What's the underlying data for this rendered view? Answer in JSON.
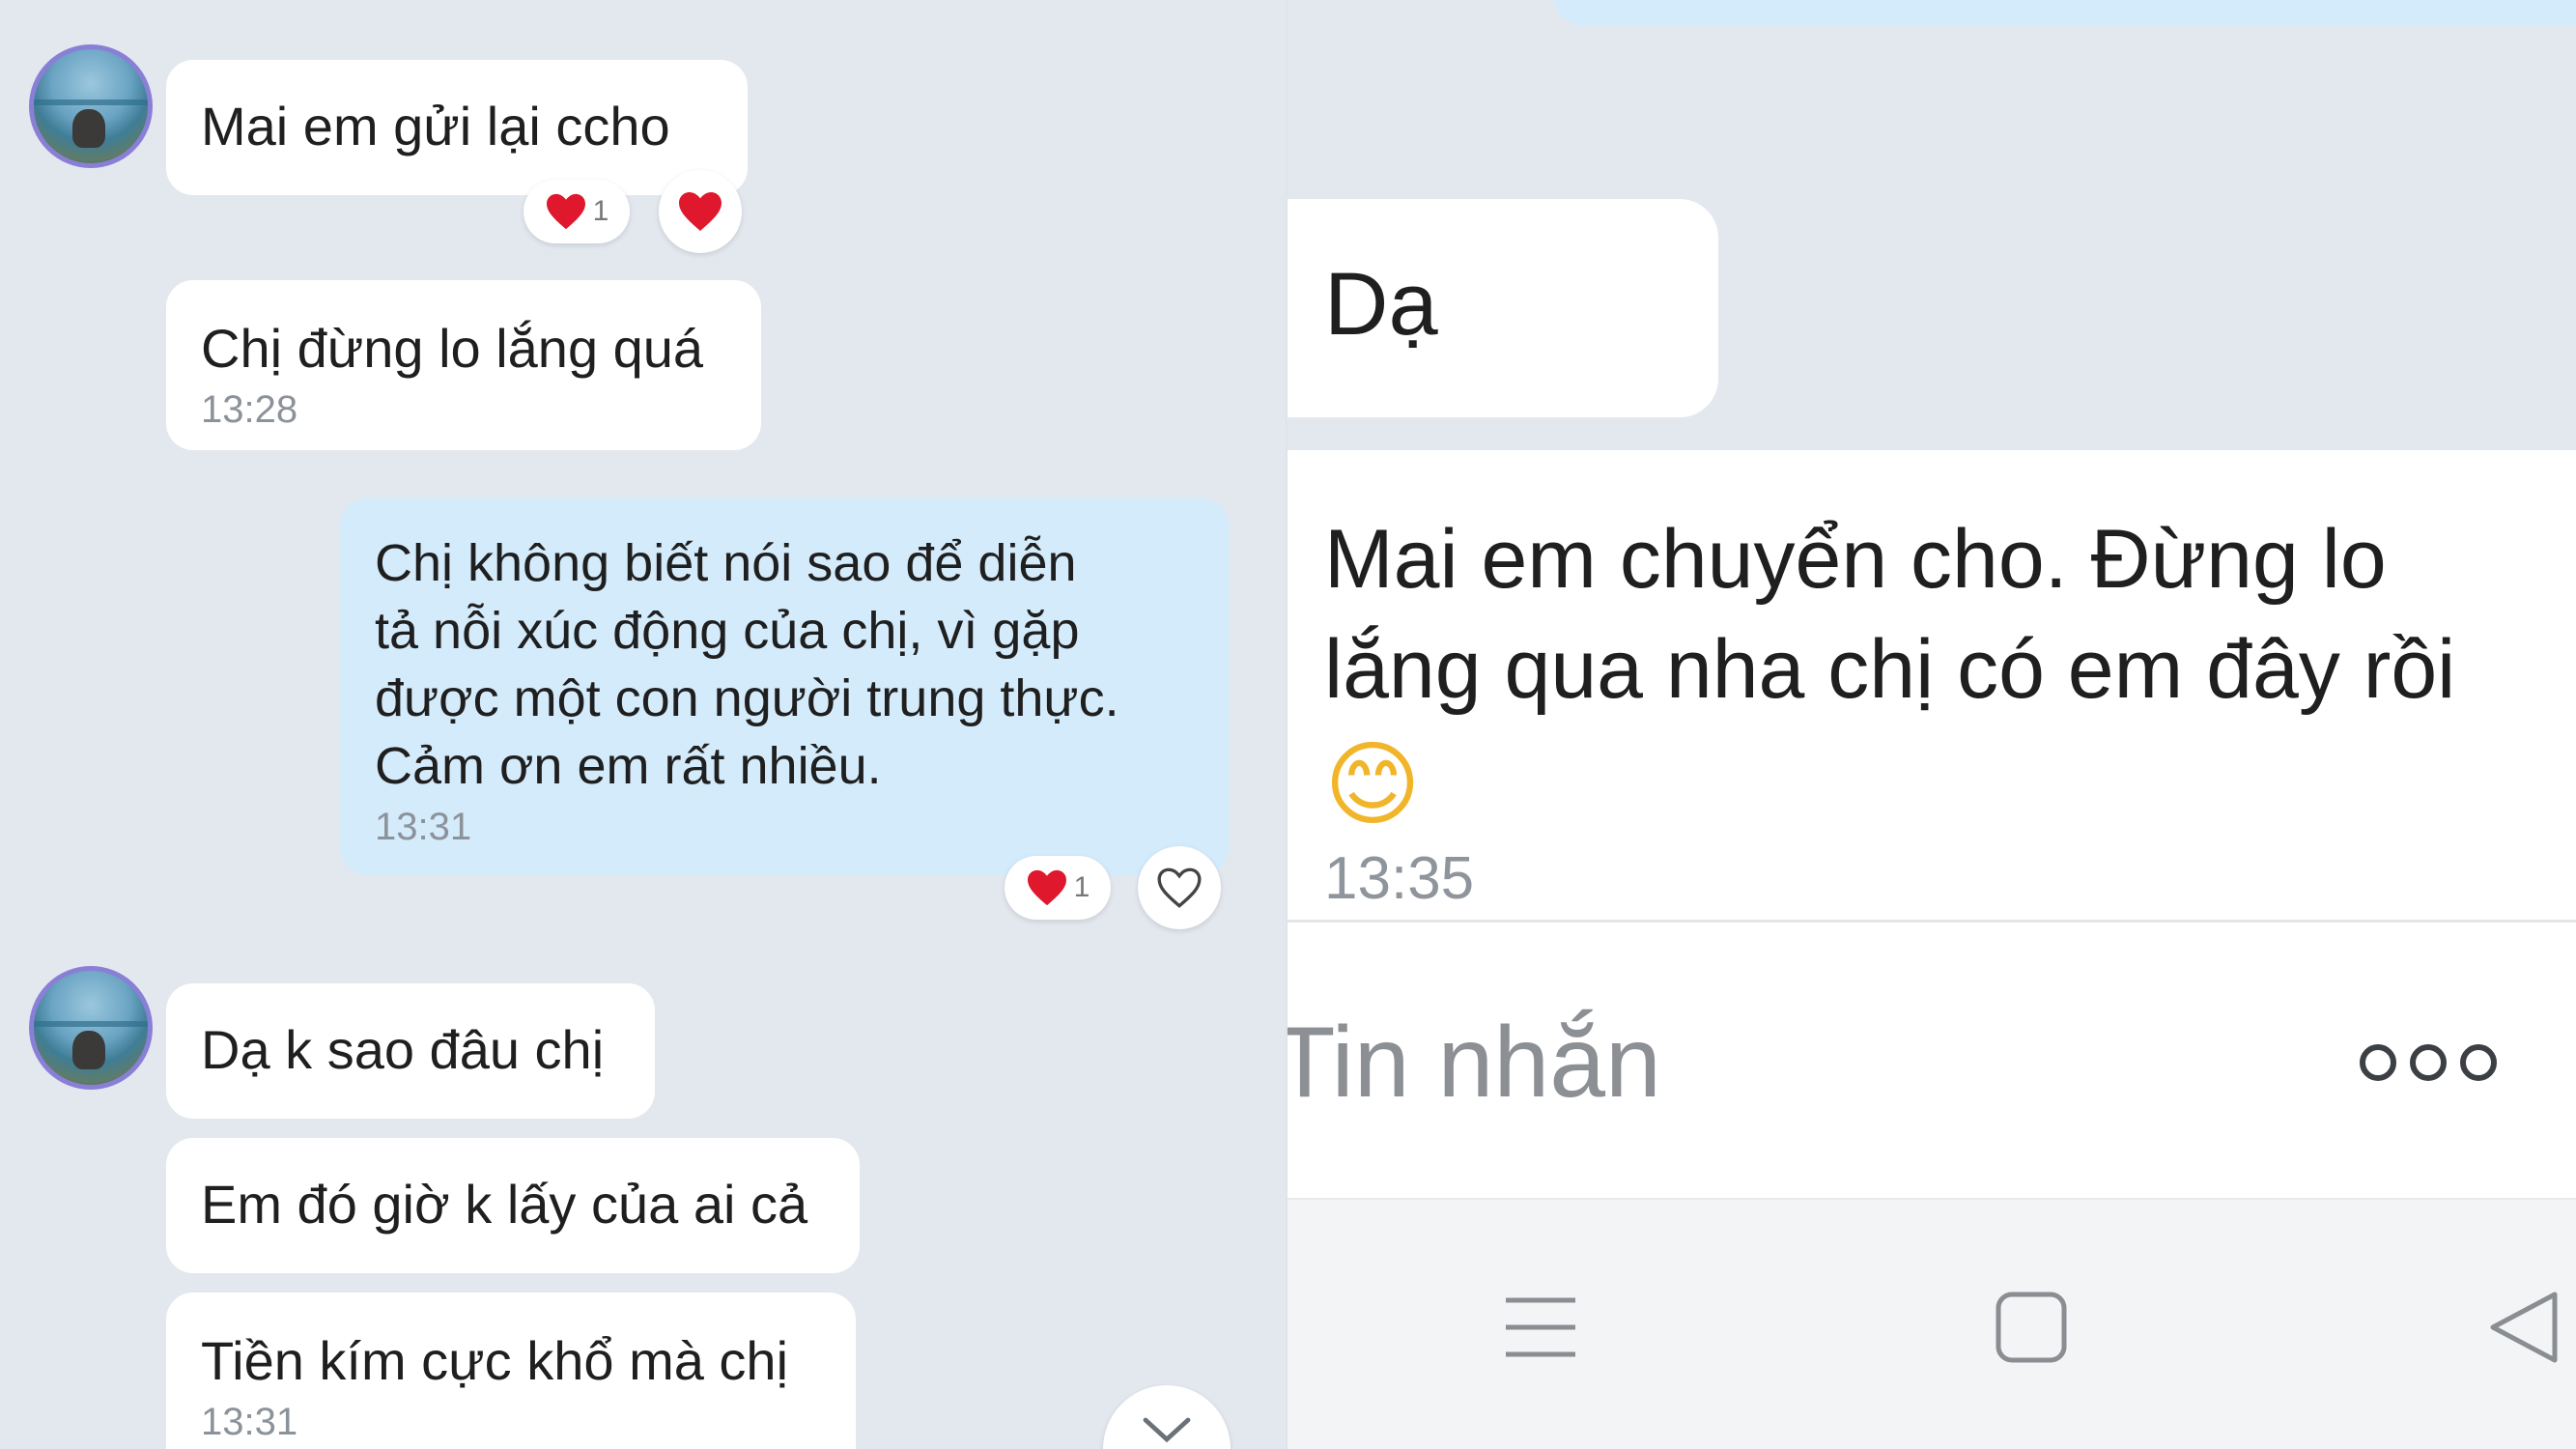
{
  "left": {
    "messages": [
      {
        "text": "Mai em gửi lại ccho",
        "reaction_count": "1"
      },
      {
        "text": "Chị đừng lo lắng quá",
        "time": "13:28"
      },
      {
        "text": "Chị không biết nói sao để diễn\ntả nỗi xúc động của chị, vì gặp\nđược một con người trung thực.\nCảm ơn em rất nhiều.",
        "time": "13:31",
        "reaction_count": "1"
      },
      {
        "text": "Dạ k sao đâu chị"
      },
      {
        "text": "Em đó giờ k lấy của ai cả"
      },
      {
        "text": "Tiền kím cực khổ mà chị",
        "time": "13:31"
      }
    ]
  },
  "right": {
    "messages": [
      {
        "text": "Dạ"
      },
      {
        "text": "Mai em chuyển cho. Đừng lo\nlắng qua nha chị có em đây rồi",
        "emoji": "😊",
        "time": "13:35"
      }
    ],
    "composer": {
      "placeholder": "Tin nhắn"
    }
  },
  "colors": {
    "background": "#e3e8ef",
    "incoming_bubble": "#ffffff",
    "outgoing_bubble": "#d4ebfb",
    "heart": "#e0182d",
    "timestamp": "#8c929a"
  },
  "icons": [
    "heart-icon",
    "heart-outline-icon",
    "chevron-down-icon",
    "more-options-icon",
    "menu-icon",
    "home-square-icon",
    "back-triangle-icon"
  ]
}
